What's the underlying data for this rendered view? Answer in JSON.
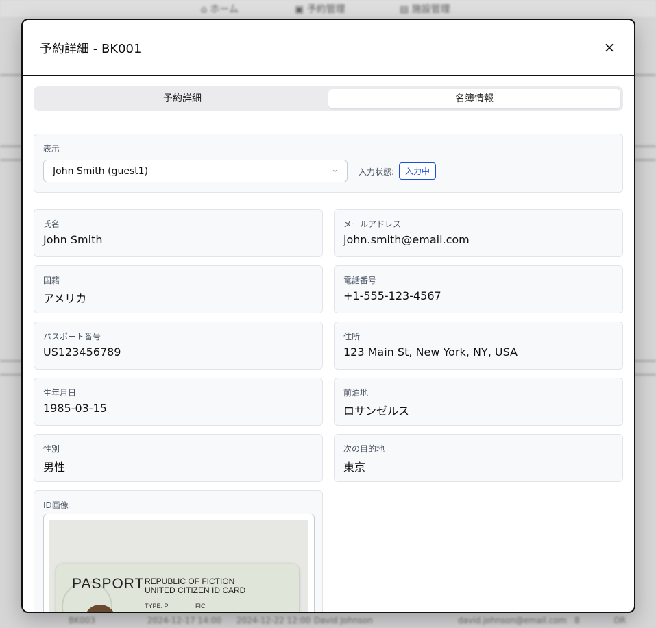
{
  "background": {
    "nav": [
      {
        "icon": "home-icon",
        "label": "ホーム"
      },
      {
        "icon": "calendar-icon",
        "label": "予約管理"
      },
      {
        "icon": "building-icon",
        "label": "施設管理"
      }
    ],
    "bottom_row": {
      "id": "BK003",
      "checkin": "2024-12-17 14:00",
      "checkout": "2024-12-22 12:00",
      "name": "David Johnson",
      "email": "david.johnson@email.com",
      "count": "8",
      "action": "OR"
    }
  },
  "modal": {
    "title": "予約詳細 - BK001",
    "close_symbol": "×",
    "tabs": [
      {
        "label": "予約詳細",
        "active": false
      },
      {
        "label": "名簿情報",
        "active": true
      }
    ],
    "display": {
      "label": "表示",
      "selected_guest": "John Smith (guest1)",
      "chevron": "⌄",
      "status_label": "入力状態:",
      "status_value": "入力中",
      "status_color": "#1d4ed8"
    },
    "fields": {
      "name": {
        "label": "氏名",
        "value": "John Smith"
      },
      "email": {
        "label": "メールアドレス",
        "value": "john.smith@email.com"
      },
      "nationality": {
        "label": "国籍",
        "value": "アメリカ"
      },
      "phone": {
        "label": "電話番号",
        "value": "+1-555-123-4567"
      },
      "passport": {
        "label": "パスポート番号",
        "value": "US123456789"
      },
      "address": {
        "label": "住所",
        "value": "123 Main St, New York, NY, USA"
      },
      "birthdate": {
        "label": "生年月日",
        "value": "1985-03-15"
      },
      "previous_stay": {
        "label": "前泊地",
        "value": "ロサンゼルス"
      },
      "gender": {
        "label": "性別",
        "value": "男性"
      },
      "next_destination": {
        "label": "次の目的地",
        "value": "東京"
      }
    },
    "id_image": {
      "label": "ID画像",
      "passport_title": "PASPORT",
      "line1": "REPUBLIC OF FICTION",
      "line2": "UNITED CITIZEN ID CARD",
      "type": "TYPE: P",
      "code": "FIC"
    }
  }
}
